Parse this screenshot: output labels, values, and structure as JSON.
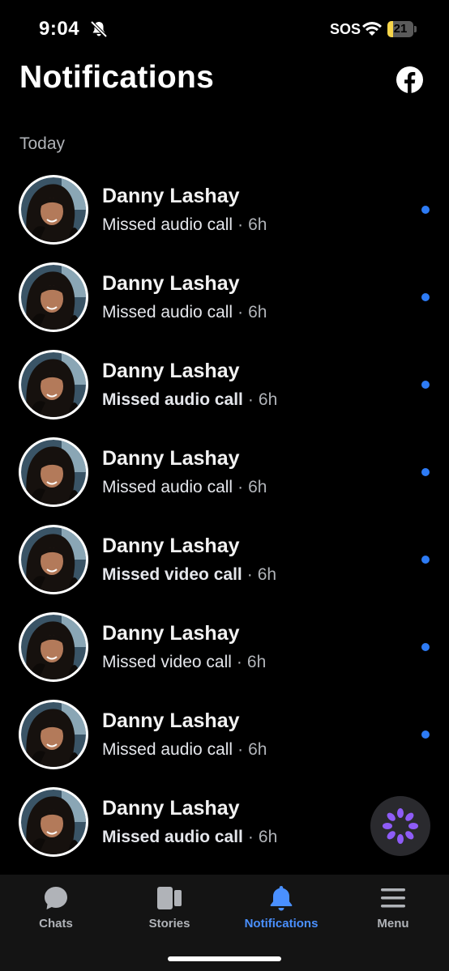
{
  "status_bar": {
    "time": "9:04",
    "carrier": "SOS",
    "battery": "21",
    "battery_level": 0.21,
    "battery_color": "#f7d54a",
    "icons": [
      "bell-slash-icon",
      "wifi-icon",
      "battery-icon"
    ]
  },
  "header": {
    "title": "Notifications",
    "facebook_icon": "facebook-icon"
  },
  "section": {
    "label": "Today"
  },
  "notifications": [
    {
      "name": "Danny Lashay",
      "action": "Missed audio call",
      "separator": "·",
      "time": "6h",
      "bold": false,
      "unread": true
    },
    {
      "name": "Danny Lashay",
      "action": "Missed audio call",
      "separator": "·",
      "time": "6h",
      "bold": false,
      "unread": true
    },
    {
      "name": "Danny Lashay",
      "action": "Missed audio call",
      "separator": "·",
      "time": "6h",
      "bold": true,
      "unread": true
    },
    {
      "name": "Danny Lashay",
      "action": "Missed audio call",
      "separator": "·",
      "time": "6h",
      "bold": false,
      "unread": true
    },
    {
      "name": "Danny Lashay",
      "action": "Missed video call",
      "separator": "·",
      "time": "6h",
      "bold": true,
      "unread": true
    },
    {
      "name": "Danny Lashay",
      "action": "Missed video call",
      "separator": "·",
      "time": "6h",
      "bold": false,
      "unread": true
    },
    {
      "name": "Danny Lashay",
      "action": "Missed audio call",
      "separator": "·",
      "time": "6h",
      "bold": false,
      "unread": true
    },
    {
      "name": "Danny Lashay",
      "action": "Missed audio call",
      "separator": "·",
      "time": "6h",
      "bold": true,
      "unread": false
    }
  ],
  "fab": {
    "icon": "meta-ai-icon"
  },
  "tab_bar": {
    "tabs": [
      {
        "label": "Chats",
        "icon": "chat-bubble-icon",
        "active": false
      },
      {
        "label": "Stories",
        "icon": "stories-icon",
        "active": false
      },
      {
        "label": "Notifications",
        "icon": "bell-icon",
        "active": true
      },
      {
        "label": "Menu",
        "icon": "hamburger-menu-icon",
        "active": false
      }
    ]
  },
  "colors": {
    "background": "#000000",
    "accent": "#4a90ff",
    "unread_dot": "#2d7bf5",
    "secondary_text": "#b0b3b8"
  }
}
